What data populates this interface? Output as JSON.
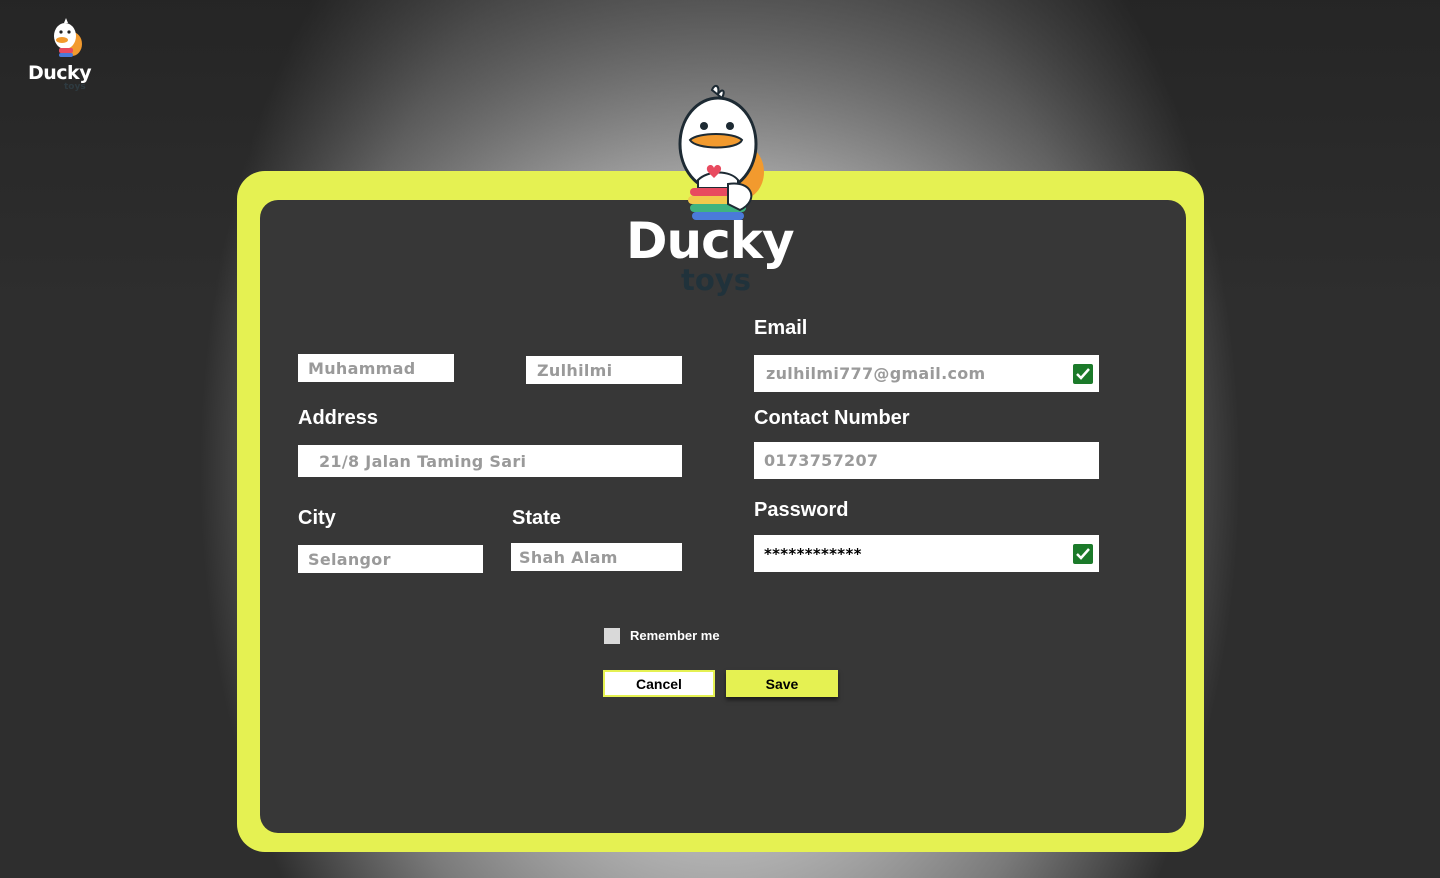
{
  "brand": {
    "name": "Ducky",
    "sub": "toys",
    "accent_color": "#e5f152",
    "panel_color": "#373737"
  },
  "form": {
    "first_name": {
      "value": "Muhammad"
    },
    "last_name": {
      "value": "Zulhilmi"
    },
    "address": {
      "label": "Address",
      "value": "21/8 Jalan Taming Sari"
    },
    "city": {
      "label": "City",
      "value": "Selangor"
    },
    "state": {
      "label": "State",
      "value": "Shah Alam"
    },
    "email": {
      "label": "Email",
      "value": "zulhilmi777@gmail.com",
      "verified": true
    },
    "contact": {
      "label": "Contact Number",
      "value": "0173757207"
    },
    "password": {
      "label": "Password",
      "value": "************",
      "verified": true
    },
    "remember": {
      "label": "Remember me",
      "checked": false
    }
  },
  "actions": {
    "cancel_label": "Cancel",
    "save_label": "Save"
  },
  "icons": {
    "check": "check-icon",
    "mascot": "duck-mascot-icon"
  }
}
